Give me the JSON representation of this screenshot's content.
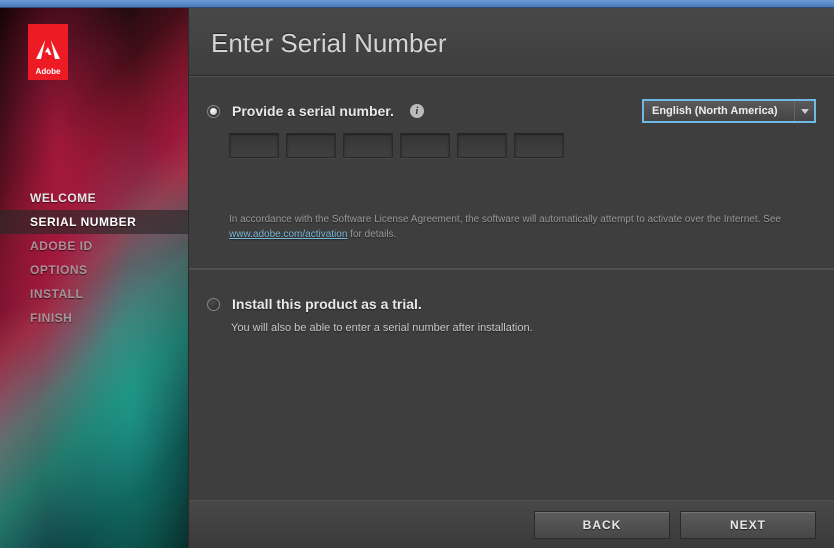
{
  "brand": {
    "name": "Adobe"
  },
  "nav": {
    "items": [
      {
        "label": "WELCOME",
        "state": "done"
      },
      {
        "label": "SERIAL NUMBER",
        "state": "active"
      },
      {
        "label": "ADOBE ID",
        "state": "pending"
      },
      {
        "label": "OPTIONS",
        "state": "pending"
      },
      {
        "label": "INSTALL",
        "state": "pending"
      },
      {
        "label": "FINISH",
        "state": "pending"
      }
    ]
  },
  "header": {
    "title": "Enter Serial Number"
  },
  "options": {
    "serial": {
      "label": "Provide a serial number.",
      "selected": true,
      "info_icon": "i"
    },
    "trial": {
      "label": "Install this product as a trial.",
      "selected": false,
      "subtext": "You will also be able to enter a serial number after installation."
    }
  },
  "language": {
    "selected": "English (North America)"
  },
  "serial_fields": {
    "count": 6
  },
  "disclaimer": {
    "prefix": "In accordance with the Software License Agreement, the software will automatically attempt to activate over the Internet. See ",
    "link_text": "www.adobe.com/activation",
    "suffix": " for details."
  },
  "footer": {
    "back": "BACK",
    "next": "NEXT"
  }
}
